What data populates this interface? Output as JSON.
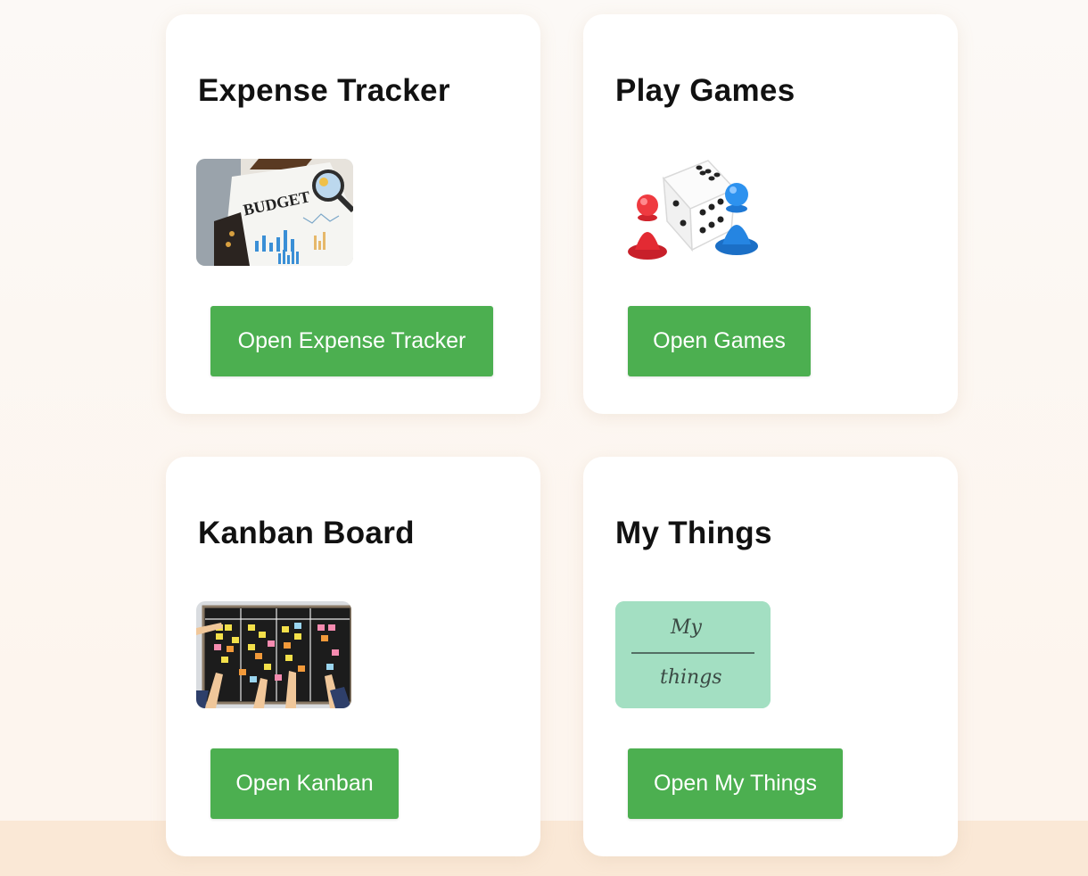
{
  "cards": [
    {
      "title": "Expense Tracker",
      "button_label": "Open Expense Tracker",
      "image_text": "BUDGET",
      "icon": "budget-report-image"
    },
    {
      "title": "Play Games",
      "button_label": "Open Games",
      "icon": "dice-and-pawns-image"
    },
    {
      "title": "Kanban Board",
      "button_label": "Open Kanban",
      "icon": "kanban-board-image"
    },
    {
      "title": "My Things",
      "button_label": "Open My Things",
      "image_text_top": "My",
      "image_text_bottom": "things",
      "icon": "my-things-image"
    }
  ],
  "colors": {
    "button": "#4caf50",
    "button_text": "#ffffff",
    "card": "#ffffff",
    "page_background": "#fdf8f3",
    "footer_band": "#fae8d6",
    "my_things_tile": "#a3dfc2"
  }
}
